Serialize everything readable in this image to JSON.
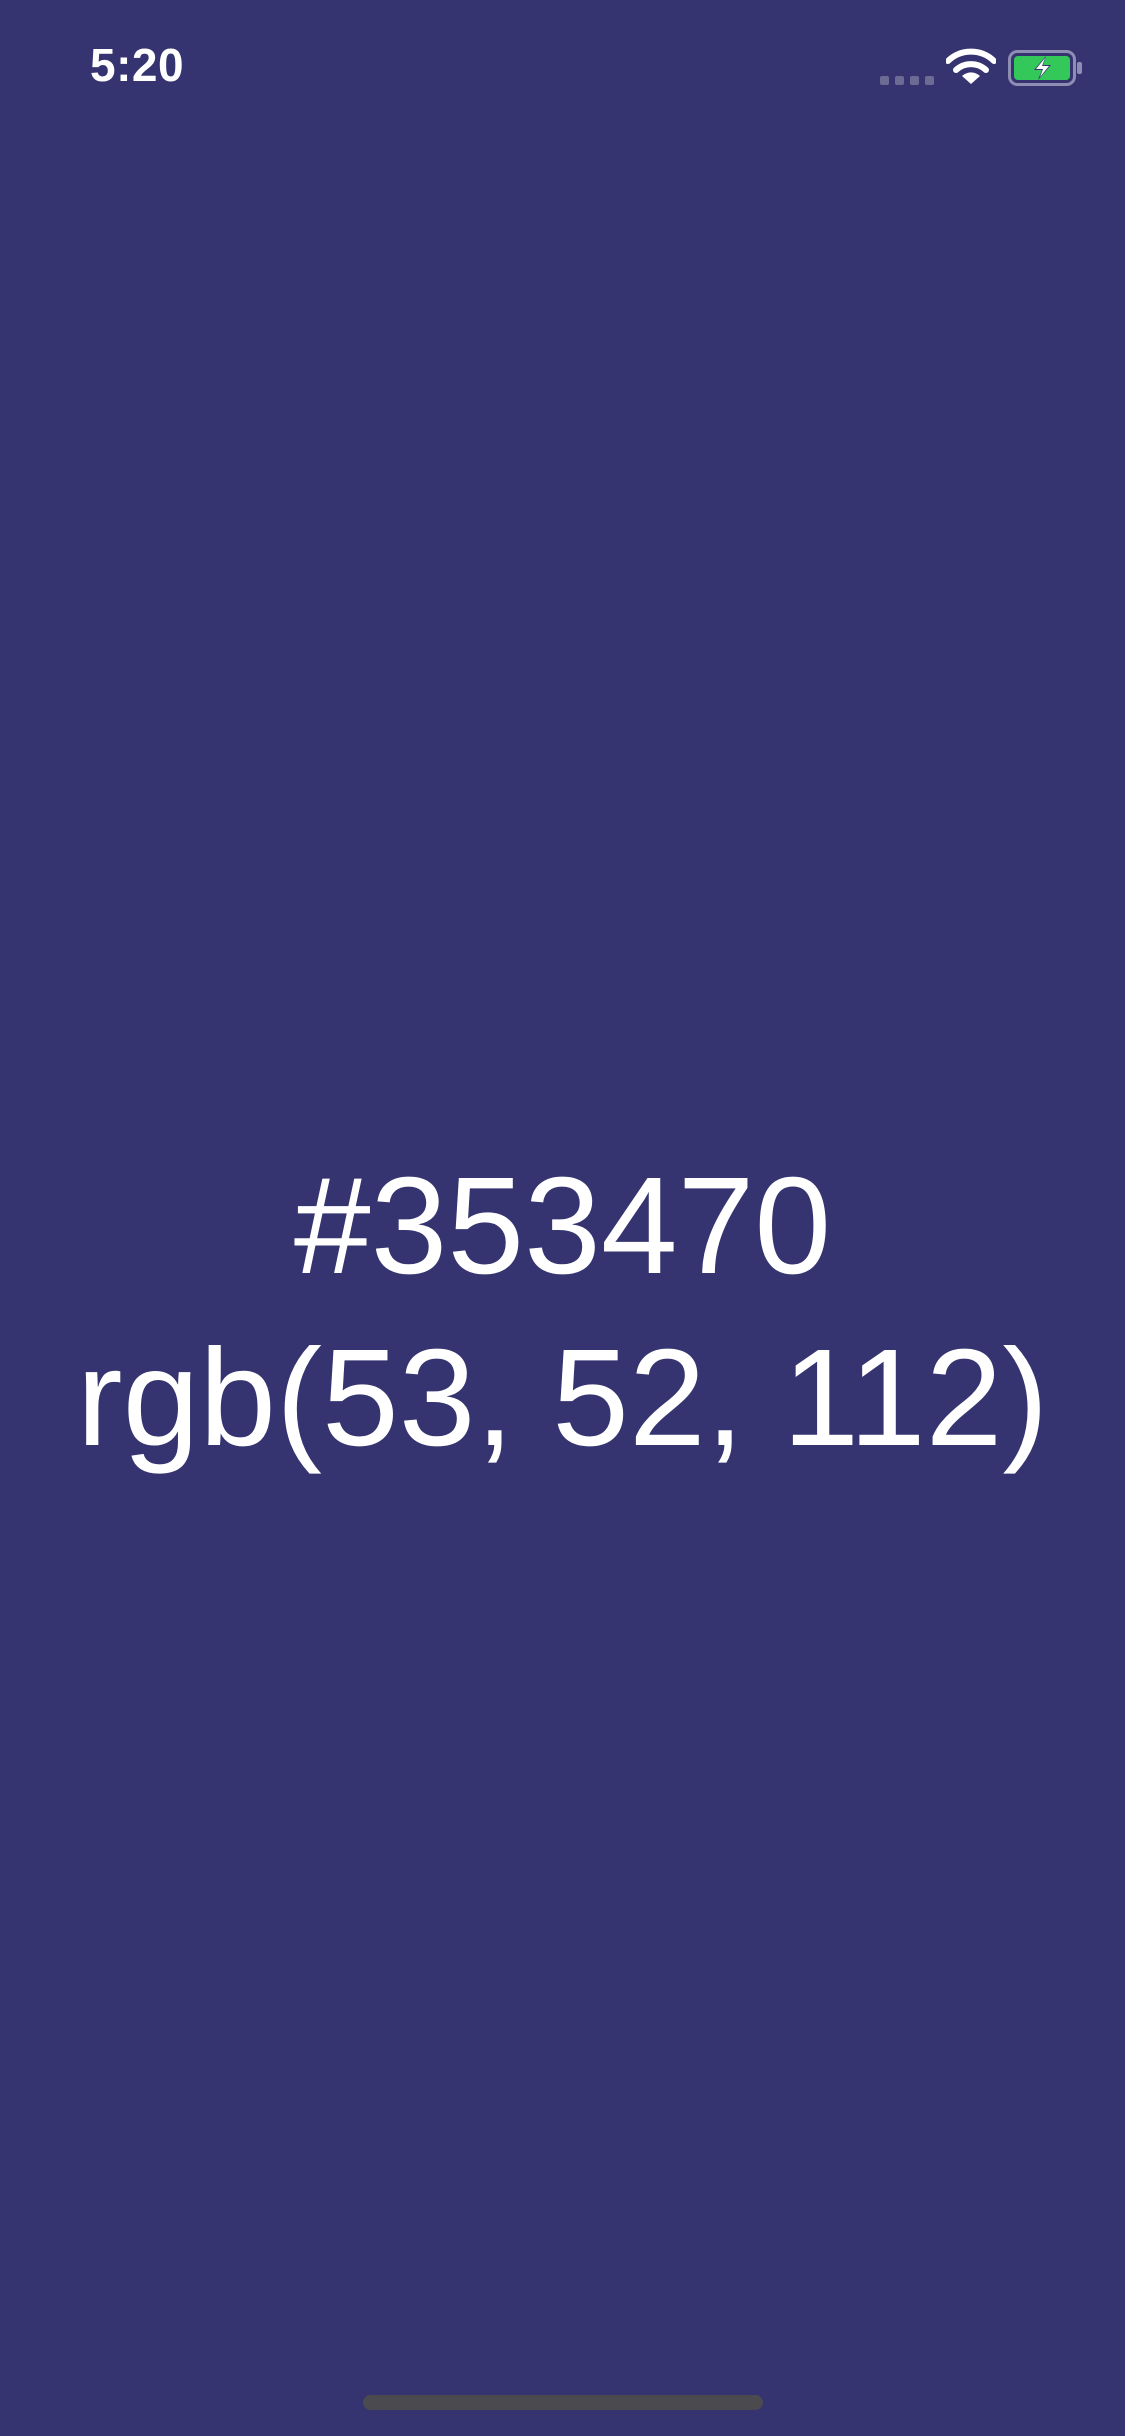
{
  "status_bar": {
    "time": "5:20",
    "icons": [
      "signal-icon",
      "wifi-icon",
      "battery-charging-icon"
    ]
  },
  "color": {
    "hex": "#353470",
    "rgb": "rgb(53, 52, 112)"
  },
  "colors": {
    "background": "#353470",
    "text": "#ffffff",
    "battery_fill": "#34c759",
    "home_indicator": "#4b4b4f"
  }
}
